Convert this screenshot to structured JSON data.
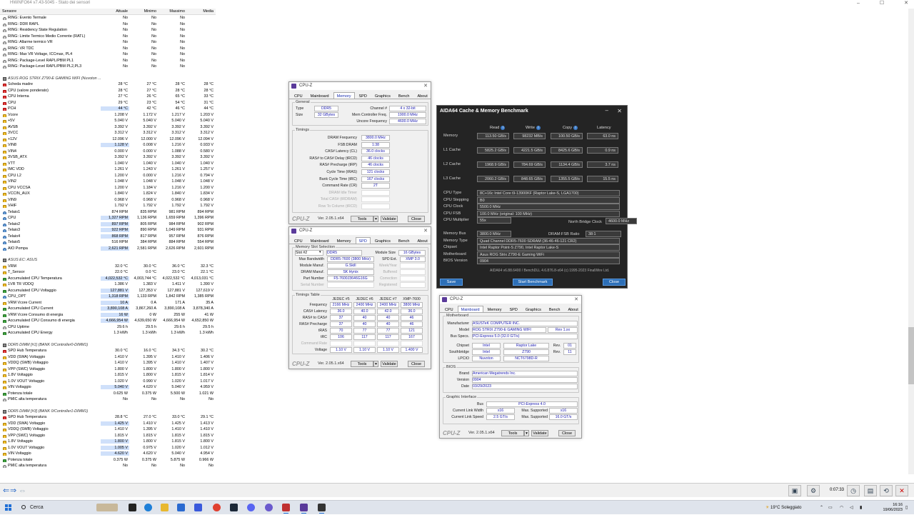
{
  "hwinfo": {
    "title": "HWiNFO64 v7.43-5045 - Stato dei sensori",
    "headers": [
      "Sensore",
      "Attuale",
      "Minimo",
      "Massimo",
      "Media"
    ],
    "rows": [
      [
        "i",
        "RING: Evento Termale",
        "No",
        "No",
        "No",
        ""
      ],
      [
        "i",
        "RING: DDR RAPL",
        "No",
        "No",
        "No",
        ""
      ],
      [
        "i",
        "RING: Residency State Regulation",
        "No",
        "No",
        "No",
        ""
      ],
      [
        "i",
        "RING: Limite Termico Medio Corrente (RATL)",
        "No",
        "No",
        "No",
        ""
      ],
      [
        "i",
        "RING: Allarme termico VR",
        "No",
        "No",
        "No",
        ""
      ],
      [
        "i",
        "RING: VR TDC",
        "No",
        "No",
        "No",
        ""
      ],
      [
        "i",
        "RING: Max VR Voltage, ICCmax, PL4",
        "No",
        "No",
        "No",
        ""
      ],
      [
        "i",
        "RING: Package-Level RAPL/PBM PL1",
        "No",
        "No",
        "No",
        ""
      ],
      [
        "i",
        "RING: Package-Level RAPL/PBM PL2,PL3",
        "No",
        "No",
        "No",
        ""
      ],
      [
        "g",
        "ASUS ROG STRIX Z790-E GAMING WIFI (Nuvoton ..."
      ],
      [
        "t",
        "Scheda madre",
        "28 °C",
        "27 °C",
        "28 °C",
        "28 °C"
      ],
      [
        "t",
        "CPU (valore ponderato)",
        "28 °C",
        "27 °C",
        "28 °C",
        "28 °C"
      ],
      [
        "t",
        "CPU Interna",
        "27 °C",
        "26 °C",
        "65 °C",
        "33 °C"
      ],
      [
        "t",
        "CPU",
        "29 °C",
        "23 °C",
        "54 °C",
        "31 °C"
      ],
      [
        "t",
        "PCH",
        "44 °C",
        "42 °C",
        "46 °C",
        "44 °C",
        "hl"
      ],
      [
        "v",
        "Vcore",
        "1.208 V",
        "1.172 V",
        "1.217 V",
        "1.203 V"
      ],
      [
        "v",
        "+5V",
        "5.040 V",
        "5.040 V",
        "5.040 V",
        "5.040 V"
      ],
      [
        "v",
        "AVSB",
        "3.392 V",
        "3.392 V",
        "3.392 V",
        "3.392 V"
      ],
      [
        "v",
        "3VCC",
        "3.312 V",
        "3.312 V",
        "3.312 V",
        "3.312 V"
      ],
      [
        "v",
        "+12V",
        "12.096 V",
        "12.000 V",
        "12.096 V",
        "12.094 V"
      ],
      [
        "v",
        "VIN8",
        "1.128 V",
        "0.008 V",
        "1.216 V",
        "0.933 V",
        "hl"
      ],
      [
        "v",
        "VIN4",
        "0.000 V",
        "0.000 V",
        "1.088 V",
        "0.580 V"
      ],
      [
        "v",
        "3VSB_ATX",
        "3.392 V",
        "3.392 V",
        "3.392 V",
        "3.392 V"
      ],
      [
        "v",
        "VTT",
        "1.040 V",
        "1.040 V",
        "1.040 V",
        "1.040 V"
      ],
      [
        "v",
        "IMC VDD",
        "1.261 V",
        "1.243 V",
        "1.261 V",
        "1.257 V"
      ],
      [
        "v",
        "CPU L2",
        "1.200 V",
        "0.000 V",
        "1.216 V",
        "0.794 V"
      ],
      [
        "v",
        "VIN2",
        "1.048 V",
        "1.048 V",
        "1.048 V",
        "1.048 V"
      ],
      [
        "v",
        "CPU VCCSA",
        "1.200 V",
        "1.184 V",
        "1.216 V",
        "1.200 V"
      ],
      [
        "v",
        "VCCIN_AUX",
        "1.840 V",
        "1.824 V",
        "1.840 V",
        "1.834 V"
      ],
      [
        "v",
        "VIN9",
        "0.968 V",
        "0.968 V",
        "0.968 V",
        "0.968 V"
      ],
      [
        "v",
        "VHIF",
        "1.792 V",
        "1.792 V",
        "1.792 V",
        "1.792 V"
      ],
      [
        "f",
        "Telaio1",
        "874 RPM",
        "835 RPM",
        "981 RPM",
        "894 RPM"
      ],
      [
        "f",
        "CPU",
        "1,327 RPM",
        "1,136 RPM",
        "1,659 RPM",
        "1,396 RPM",
        "hl"
      ],
      [
        "f",
        "Telaio2",
        "897 RPM",
        "805 RPM",
        "984 RPM",
        "902 RPM",
        "hl"
      ],
      [
        "f",
        "Telaio3",
        "922 RPM",
        "890 RPM",
        "1,049 RPM",
        "931 RPM",
        "hl"
      ],
      [
        "f",
        "Telaio4",
        "868 RPM",
        "817 RPM",
        "957 RPM",
        "876 RPM",
        "hl"
      ],
      [
        "f",
        "Telaio5",
        "516 RPM",
        "384 RPM",
        "884 RPM",
        "554 RPM"
      ],
      [
        "f",
        "AIO Pompa",
        "2,621 RPM",
        "2,581 RPM",
        "2,626 RPM",
        "2,601 RPM",
        "hl"
      ],
      [
        "g",
        "ASUS EC: ASUS"
      ],
      [
        "v",
        "VRM",
        "32.0 °C",
        "30.0 °C",
        "36.0 °C",
        "32.3 °C"
      ],
      [
        "v",
        "T_Sensor",
        "22.0 °C",
        "0.0 °C",
        "23.0 °C",
        "22.1 °C"
      ],
      [
        "p",
        "Accumulated CPU Temperatura",
        "4,022,532 °C",
        "4,003,744 °C",
        "4,022,532 °C",
        "4,013,031 °C",
        "hl"
      ],
      [
        "v",
        "1VR TR VDDQ",
        "1.386 V",
        "1.383 V",
        "1.411 V",
        "1.390 V"
      ],
      [
        "p",
        "Accumulated CPU Voltaggio",
        "127,881 V",
        "127,353 V",
        "127,881 V",
        "127,619 V",
        "hl"
      ],
      [
        "f",
        "CPU_OPT",
        "1,318 RPM",
        "1,133 RPM",
        "1,842 RPM",
        "1,385 RPM",
        "hl"
      ],
      [
        "v",
        "VRM Vcore Current",
        "10 A",
        "0 A",
        "171 A",
        "35 A",
        "hl"
      ],
      [
        "p",
        "Accumulated CPU Current",
        "3,890,108 A",
        "3,867,260 A",
        "3,890,108 A",
        "3,878,340 A",
        "hl"
      ],
      [
        "p",
        "VRM Vcore Consumo di energia",
        "16 W",
        "0 W",
        "255 W",
        "41 W",
        "hl"
      ],
      [
        "p",
        "Accumulated CPU Consumo di energia",
        "4,666,954 W",
        "4,639,650 W",
        "4,666,954 W",
        "4,652,850 W",
        "hl"
      ],
      [
        "i",
        "CPU Uptime",
        "29.6 h",
        "29.5 h",
        "29.6 h",
        "29.5 h"
      ],
      [
        "p",
        "Accumulated CPU Energy",
        "1.3 kWh",
        "1.3 kWh",
        "1.3 kWh",
        "1.3 kWh"
      ],
      [
        "g",
        "DDR5 DIMM [#1] (BANK 0/Controller0-DIMM1)"
      ],
      [
        "t",
        "SPD Hub Temperatura",
        "30.0 °C",
        "16.0 °C",
        "34.3 °C",
        "30.2 °C"
      ],
      [
        "v",
        "VDD (SWA) Voltaggio",
        "1.410 V",
        "1.395 V",
        "1.410 V",
        "1.406 V"
      ],
      [
        "v",
        "VDDQ (SWB) Voltaggio",
        "1.410 V",
        "1.395 V",
        "1.410 V",
        "1.407 V"
      ],
      [
        "v",
        "VPP (SWC) Voltaggio",
        "1.800 V",
        "1.800 V",
        "1.800 V",
        "1.800 V"
      ],
      [
        "v",
        "1.8V Voltaggio",
        "1.815 V",
        "1.800 V",
        "1.815 V",
        "1.814 V"
      ],
      [
        "v",
        "1.0V VOUT Voltaggio",
        "1.020 V",
        "0.990 V",
        "1.020 V",
        "1.017 V"
      ],
      [
        "v",
        "VIN Voltaggio",
        "5.040 V",
        "4.620 V",
        "5.040 V",
        "4.959 V",
        "hl"
      ],
      [
        "p",
        "Potenza totale",
        "0.625 W",
        "0.375 W",
        "5.500 W",
        "1.021 W"
      ],
      [
        "i",
        "PMIC alta temperatura",
        "No",
        "No",
        "No",
        "No"
      ],
      [
        "g",
        "DDR5 DIMM [#3] (BANK 0/Controller1-DIMM1)"
      ],
      [
        "t",
        "SPD Hub Temperatura",
        "28.8 °C",
        "27.0 °C",
        "33.0 °C",
        "29.1 °C"
      ],
      [
        "v",
        "VDD (SWA) Voltaggio",
        "1.425 V",
        "1.410 V",
        "1.425 V",
        "1.413 V",
        "hl"
      ],
      [
        "v",
        "VDDQ (SWB) Voltaggio",
        "1.410 V",
        "1.395 V",
        "1.410 V",
        "1.410 V"
      ],
      [
        "v",
        "VPP (SWC) Voltaggio",
        "1.815 V",
        "1.815 V",
        "1.815 V",
        "1.815 V"
      ],
      [
        "v",
        "1.8V Voltaggio",
        "1.800 V",
        "1.800 V",
        "1.815 V",
        "1.800 V",
        "hl"
      ],
      [
        "v",
        "1.0V VOUT Voltaggio",
        "1.005 V",
        "0.975 V",
        "1.020 V",
        "1.012 V",
        "hl"
      ],
      [
        "v",
        "VIN Voltaggio",
        "4.620 V",
        "4.620 V",
        "5.040 V",
        "4.954 V",
        "hl"
      ],
      [
        "p",
        "Potenza totale",
        "0.375 W",
        "0.375 W",
        "5.875 W",
        "0.966 W"
      ],
      [
        "i",
        "PMIC alta temperatura",
        "No",
        "No",
        "No",
        "No"
      ]
    ],
    "uptime": "0:07:33"
  },
  "cpuz_mem": {
    "title": "CPU-Z",
    "tabs": [
      "CPU",
      "Mainboard",
      "Memory",
      "SPD",
      "Graphics",
      "Bench",
      "About"
    ],
    "active": 2,
    "general_legend": "General",
    "type_lab": "Type",
    "type": "DDR5",
    "size_lab": "Size",
    "size": "32 GBytes",
    "chan_lab": "Channel #",
    "chan": "4 x 32-bit",
    "mcf_lab": "Mem Controller Freq.",
    "mcf": "1900.0 MHz",
    "unc_lab": "Uncore Frequency",
    "unc": "4600.0 MHz",
    "timings_legend": "Timings",
    "timings": [
      [
        "DRAM Frequency",
        "3800.0 MHz"
      ],
      [
        "FSB:DRAM",
        "1:38"
      ],
      [
        "CAS# Latency (CL)",
        "36.0 clocks"
      ],
      [
        "RAS# to CAS# Delay (tRCD)",
        "46 clocks"
      ],
      [
        "RAS# Precharge (tRP)",
        "46 clocks"
      ],
      [
        "Cycle Time (tRAS)",
        "121 clocks"
      ],
      [
        "Bank Cycle Time (tRC)",
        "167 clocks"
      ],
      [
        "Command Rate (CR)",
        "2T"
      ],
      [
        "DRAM Idle Timer",
        ""
      ],
      [
        "Total CAS# (tRDRAM)",
        ""
      ],
      [
        "Row To Column (tRCD)",
        ""
      ]
    ],
    "ver": "Ver. 2.05.1.x64",
    "tools": "Tools",
    "validate": "Validate",
    "close": "Close",
    "logo": "CPU-Z"
  },
  "cpuz_spd": {
    "title": "CPU-Z",
    "tabs": [
      "CPU",
      "Mainboard",
      "Memory",
      "SPD",
      "Graphics",
      "Bench",
      "About"
    ],
    "active": 3,
    "slot_legend": "Memory Slot Selection",
    "slot": "Slot #2",
    "ddr": "DDR5",
    "modsize_lab": "Module Size",
    "modsize": "16 GBytes",
    "left": [
      [
        "Max Bandwidth",
        "DDR5-7600 (3800 MHz)"
      ],
      [
        "Module Manuf.",
        "G.Skill"
      ],
      [
        "DRAM Manuf.",
        "SK Hynix"
      ],
      [
        "Part Number",
        "F5-7600J3646G16G"
      ],
      [
        "Serial Number",
        ""
      ]
    ],
    "right": [
      [
        "SPD Ext.",
        "XMP 3.0"
      ],
      [
        "Week/Year",
        ""
      ],
      [
        "Buffered",
        ""
      ],
      [
        "Correction",
        ""
      ],
      [
        "Registered",
        ""
      ]
    ],
    "tt_legend": "Timings Table",
    "cols": [
      "JEDEC #5",
      "JEDEC #6",
      "JEDEC #7",
      "XMP-7600"
    ],
    "rows": [
      [
        "Frequency",
        "2166 MHz",
        "2400 MHz",
        "2400 MHz",
        "3800 MHz"
      ],
      [
        "CAS# Latency",
        "36.0",
        "40.0",
        "42.0",
        "36.0"
      ],
      [
        "RAS# to CAS#",
        "37",
        "40",
        "40",
        "46"
      ],
      [
        "RAS# Precharge",
        "37",
        "40",
        "40",
        "46"
      ],
      [
        "tRAS",
        "70",
        "77",
        "77",
        "121"
      ],
      [
        "tRC",
        "106",
        "117",
        "117",
        "167"
      ],
      [
        "Command Rate",
        "",
        "",
        "",
        ""
      ],
      [
        "Voltage",
        "1.10 V",
        "1.10 V",
        "1.10 V",
        "1.400 V"
      ]
    ],
    "ver": "Ver. 2.05.1.x64",
    "tools": "Tools",
    "validate": "Validate",
    "close": "Close",
    "logo": "CPU-Z"
  },
  "cpuz_mb": {
    "title": "CPU-Z",
    "tabs": [
      "CPU",
      "Mainboard",
      "Memory",
      "SPD",
      "Graphics",
      "Bench",
      "About"
    ],
    "active": 1,
    "mb_legend": "Motherboard",
    "manuf_lab": "Manufacturer",
    "manuf": "ASUSTeK COMPUTER INC.",
    "model_lab": "Model",
    "model": "ROG STRIX Z790-E GAMING WIFI",
    "model_rev": "Rev 1.xx",
    "bus_lab": "Bus Specs.",
    "bus": "PCI-Express 5.0 (32.0 GT/s)",
    "chipset_lab": "Chipset",
    "chipset_v": "Intel",
    "chipset_n": "Raptor Lake",
    "chipset_rl": "Rev.",
    "chipset_r": "01",
    "sb_lab": "Southbridge",
    "sb_v": "Intel",
    "sb_n": "Z790",
    "sb_rl": "Rev.",
    "sb_r": "11",
    "lpc_lab": "LPCIO",
    "lpc_v": "Nuvoton",
    "lpc_n": "NCT6798D-R",
    "bios_legend": "BIOS",
    "brand_lab": "Brand",
    "brand": "American Megatrends Inc.",
    "version_lab": "Version",
    "version": "0904",
    "date_lab": "Date",
    "date": "03/29/2023",
    "gi_legend": "Graphic Interface",
    "gbus_lab": "Bus",
    "gbus": "PCI-Express 4.0",
    "clw_lab": "Current Link Width",
    "clw": "x16",
    "msw_lab": "Max. Supported",
    "msw": "x16",
    "cls_lab": "Current Link Speed",
    "cls": "2.5 GT/s",
    "mss_lab": "Max. Supported",
    "mss": "16.0 GT/s",
    "ver": "Ver. 2.05.1.x64",
    "tools": "Tools",
    "validate": "Validate",
    "close": "Close",
    "logo": "CPU-Z"
  },
  "aida": {
    "title": "AIDA64 Cache & Memory Benchmark",
    "headers": [
      "Read",
      "Write",
      "Copy",
      "Latency"
    ],
    "bench": [
      [
        "Memory",
        "113.50 GB/s",
        "98232 MB/s",
        "100.50 GB/s",
        "63.0 ns"
      ],
      [
        "L1 Cache",
        "5825.2 GB/s",
        "4221.5 GB/s",
        "8425.6 GB/s",
        "0.9 ns"
      ],
      [
        "L2 Cache",
        "1968.9 GB/s",
        "784.69 GB/s",
        "1134.4 GB/s",
        "3.7 ns"
      ],
      [
        "L3 Cache",
        "2060.2 GB/s",
        "848.65 GB/s",
        "1355.5 GB/s",
        "15.5 ns"
      ]
    ],
    "info1": [
      [
        "CPU Type",
        "8C+16c Intel Core i9-13900KF (Raptor Lake-S, LGA1700)"
      ],
      [
        "CPU Stepping",
        "B0"
      ],
      [
        "CPU Clock",
        "5500.0 MHz"
      ],
      [
        "CPU FSB",
        "100.0 MHz (original: 100 MHz)"
      ],
      [
        "CPU Multiplier",
        "55x"
      ]
    ],
    "nb_lab": "North Bridge Clock",
    "nb": "4600.0 MHz",
    "info2": [
      [
        "Memory Bus",
        "3800.0 MHz"
      ],
      [
        "Memory Type",
        "Quad Channel DDR5-7600 SDRAM (36-46-46-121 CR2)"
      ],
      [
        "Chipset",
        "Intel Raptor Point-S Z790, Intel Raptor Lake-S"
      ],
      [
        "Motherboard",
        "Asus ROG Strix Z790-E Gaming WiFi"
      ],
      [
        "BIOS Version",
        "0904"
      ]
    ],
    "ratio_lab": "DRAM:FSB Ratio",
    "ratio": "38:1",
    "copyright": "AIDA64 v6.88.6400 / BenchDLL 4.6.876.8-x64  (c) 1995-2023 FinalWire Ltd.",
    "save": "Save",
    "start": "Start Benchmark",
    "close": "Close"
  },
  "taskbar": {
    "search": "Cerca",
    "weather": "19°C Soleggiato",
    "time": "16:16",
    "date": "19/06/2023"
  }
}
